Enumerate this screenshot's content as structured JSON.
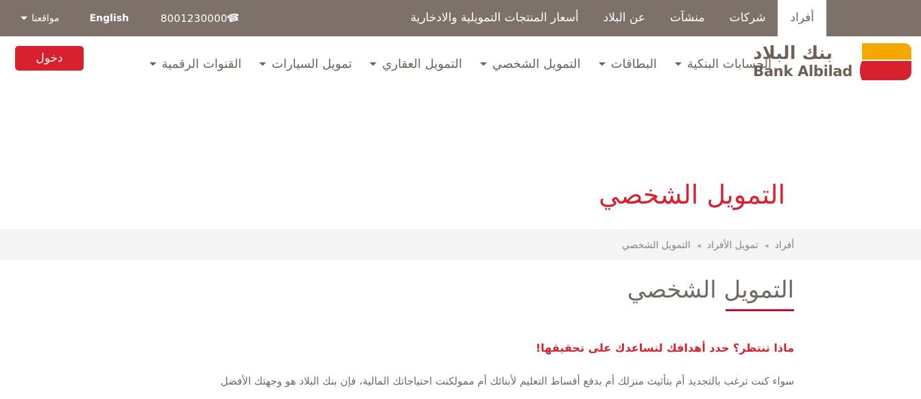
{
  "topbar": {
    "tabs": [
      {
        "label": "أفراد",
        "active": true
      },
      {
        "label": "شركات",
        "active": false
      },
      {
        "label": "منشآت",
        "active": false
      },
      {
        "label": "عن البلاد",
        "active": false
      },
      {
        "label": "أسعار المنتجات التمويلية والادخارية",
        "active": false
      }
    ],
    "phone": "8001230000",
    "phone_icon": "phone-handset-icon",
    "language": "English",
    "locations": "مواقعنا"
  },
  "navbar": {
    "logo": {
      "arabic": "بنك البلاد",
      "english": "Bank Albilad",
      "mark_colors": {
        "orange": "#f6a800",
        "red": "#d7212f"
      }
    },
    "items": [
      {
        "label": "الحسابات البنكية",
        "has_dropdown": true
      },
      {
        "label": "البطاقات",
        "has_dropdown": true
      },
      {
        "label": "التمويل الشخصي",
        "has_dropdown": true
      },
      {
        "label": "التمويل العقاري",
        "has_dropdown": true
      },
      {
        "label": "تمويل السيارات",
        "has_dropdown": true
      },
      {
        "label": "القنوات الرقمية",
        "has_dropdown": true
      }
    ],
    "login_label": "دخول"
  },
  "hero": {
    "title": "التمويل الشخصي"
  },
  "breadcrumb": {
    "separator": "◂",
    "items": [
      {
        "label": "أفراد"
      },
      {
        "label": "تمويل الأفراد"
      },
      {
        "label": "التمويل الشخصي"
      }
    ]
  },
  "content": {
    "section_title": "التمويل الشخصي",
    "subheading": "ماذا تنتظر؟ حدد أهدافك لنساعدك على تحقيقها!",
    "body": "سواء كنت ترغب بالتجديد أم بتأثيث منزلك أم بدفع أقساط التعليم لأبنائك أم ممولكنت احتياجاتك المالية، فإن بنك البلاد هو وجهتك الأفضل"
  },
  "colors": {
    "topbar_bg": "#7d7169",
    "brand_red": "#d7212f",
    "brand_orange": "#f6a800",
    "text_taupe": "#6d6159",
    "band_bg": "#f4f4f4"
  }
}
